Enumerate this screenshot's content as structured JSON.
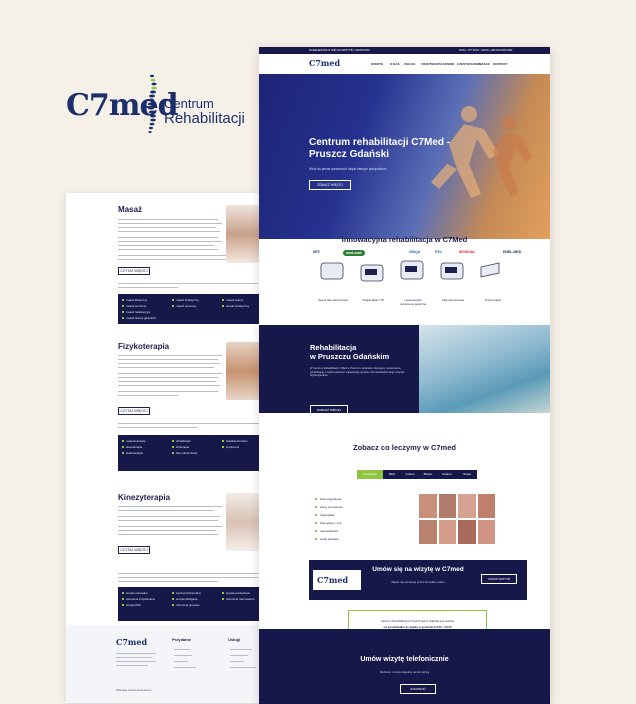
{
  "logo": {
    "brand": "C7med",
    "line1": "Centrum",
    "line2": "Rehabilitacji"
  },
  "left_page": {
    "sections": [
      {
        "title": "Masaż",
        "button": "CZYTAJ WIĘCEJ",
        "lead": "Masaż jest formą oddziaływania na tkanki miękkie ciała, dzięki któremu wspieramy procesy regeneracyjne i odprężenie.",
        "items": [
          "masaż klasyczny",
          "masaż leczniczy",
          "masaż relaksacyjny",
          "masaż tkanek głębokich",
          "masaż limfatyczny",
          "masaż sportowy",
          "masaż twarzy",
          "drenaż limfatyczny"
        ]
      },
      {
        "title": "Fizykoterapia",
        "button": "CZYTAJ WIĘCEJ",
        "lead": "Fizykoterapia to dziedzina fizjoterapii wykorzystująca czynniki fizyczne w leczeniu schorzeń narządu ruchu.",
        "items": [
          "magnetoterapia",
          "laseroterapia",
          "elektroterapia",
          "ultradźwięki",
          "krioterapia",
          "fala uderzeniowa",
          "światłolecznictwo",
          "jonoforeza"
        ]
      },
      {
        "title": "Kinezyterapia",
        "button": "CZYTAJ WIĘCEJ",
        "lead": "Kinezyterapia to leczenie ruchem, oparte na ćwiczeniach dobranych do potrzeb pacjenta.",
        "items": [
          "terapia manualna",
          "ćwiczenia indywidualne",
          "terapia PNF",
          "trening funkcjonalny",
          "terapia Mulligana",
          "ćwiczenia grupowe",
          "terapia powięziowa",
          "ćwiczenia równoważne"
        ]
      }
    ],
    "footer": {
      "col1": "Przydatne",
      "col2": "Usługi",
      "copyright": "Wszelkie prawa zastrzeżone"
    }
  },
  "right_page": {
    "topbar_left": "ZAREJESTRUJ SIĘ NA WIZYTĘ: CENTRUM",
    "topbar_right": "PON - PT 8:00 - 20:00  +48 000 000 000",
    "nav": [
      "OFERTA",
      "O NAS",
      "USŁUGI",
      "FIZJOTERAPIA",
      "CENNIK",
      "CZESTOCHOWA",
      "MASAŻ",
      "KONTAKT"
    ],
    "hero": {
      "title": "Centrum rehabilitacji C7Med - Pruszcz Gdański",
      "subtitle": "Wróć do pełnej sprawności dzięki naszym specjalistom",
      "button": "ZOBACZ WIĘCEJ"
    },
    "partners": [
      "NFZ",
      "med-med",
      "UNIQA",
      "PZU",
      "MONDIAL",
      "ENEL-MED"
    ],
    "innov_title": "Innowacyjna rehabilitacja w C7Med",
    "devices": [
      "Aparat fala uderzeniowa",
      "Terapia falami TR",
      "Laseroterapia wysokoenergetyczna",
      "Fala uderzeniowa",
      "Tecar terapia"
    ],
    "rehab": {
      "title1": "Rehabilitacja",
      "title2": "w Pruszczu Gdańskim",
      "text": "W Centrum Rehabilitacji C7Med w Pruszczu Gdańskim oferujemy nowoczesną rehabilitację z wykorzystaniem najlepszego sprzętu oraz doświadczonego zespołu fizjoterapeutów.",
      "button": "ZOBACZ WIĘCEJ"
    },
    "treat_title": "Zobacz co leczymy w C7med",
    "tabs": [
      "Kręgosłup",
      "Bark",
      "Łokieć",
      "Biodro",
      "Kolano",
      "Stopa"
    ],
    "conditions": [
      "bóle kręgosłupa",
      "stany pourazowe",
      "dyskopatia",
      "bóle głowy i szyi",
      "rwa kulszowa",
      "wady postawy"
    ],
    "appt": {
      "title": "Umów się na wizytę w C7med",
      "sub": "Zapisz się na wizytę przez formularz online",
      "button": "UMÓW WIZYTĘ"
    },
    "hours": {
      "line1": "Centrum Rehabilitacji C7med Pruszcz Gdański jest otwarte",
      "line2": "od poniedziałku do piątku w godzinach 8:00 - 20:00"
    },
    "phone": {
      "title": "Umów wizytę telefonicznie",
      "sub": "Zadzwoń i umów dogodny termin wizyty",
      "button": "ZADZWOŃ"
    }
  }
}
